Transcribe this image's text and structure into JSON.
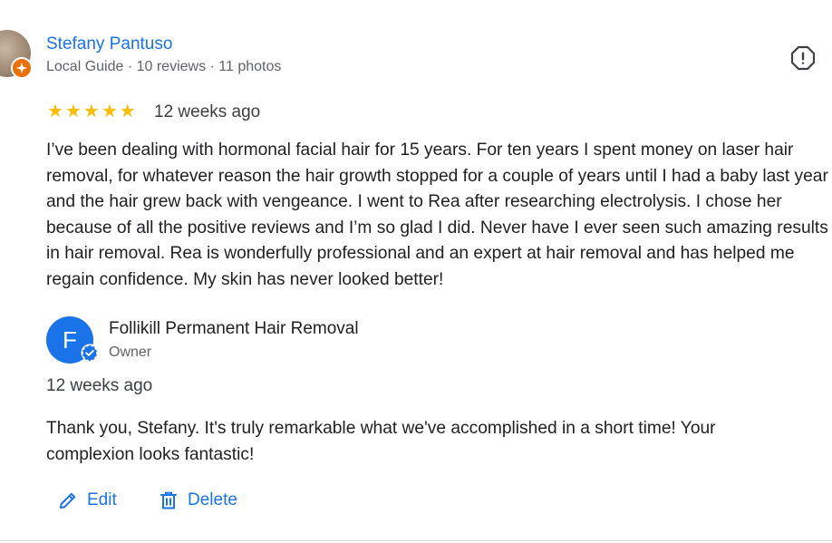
{
  "review": {
    "reviewer_name": "Stefany Pantuso",
    "reviewer_meta": "Local Guide · 10 reviews · 11 photos",
    "rating": 5,
    "stars": [
      "★",
      "★",
      "★",
      "★",
      "★"
    ],
    "time": "12 weeks ago",
    "text": "I’ve been dealing with hormonal facial hair for 15 years. For ten years I spent money on laser hair removal, for whatever reason the hair growth stopped for a couple of years until I had a baby last year and the hair grew back with vengeance. I went to Rea after researching electrolysis. I chose her because of all the positive reviews and I’m so glad I did. Never have I ever seen such amazing results in hair removal. Rea is wonderfully professional and an expert at hair removal and has helped me regain confidence. My skin has never looked better!"
  },
  "owner_reply": {
    "avatar_letter": "F",
    "name": "Follikill Permanent Hair Removal",
    "role": "Owner",
    "time": "12 weeks ago",
    "text": "Thank you, Stefany. It's truly remarkable what we've accomplished in a short time! Your complexion looks fantastic!"
  },
  "actions": {
    "edit_label": "Edit",
    "delete_label": "Delete"
  },
  "icons": {
    "flag": "report-flag-icon",
    "edit": "pencil-icon",
    "delete": "trash-icon",
    "verified": "verified-check-icon",
    "local_guide": "local-guide-badge-icon"
  },
  "colors": {
    "link_blue": "#1a73e8",
    "star_yellow": "#fbbc04",
    "guide_orange": "#e8710a",
    "secondary_text": "#5f6368"
  }
}
